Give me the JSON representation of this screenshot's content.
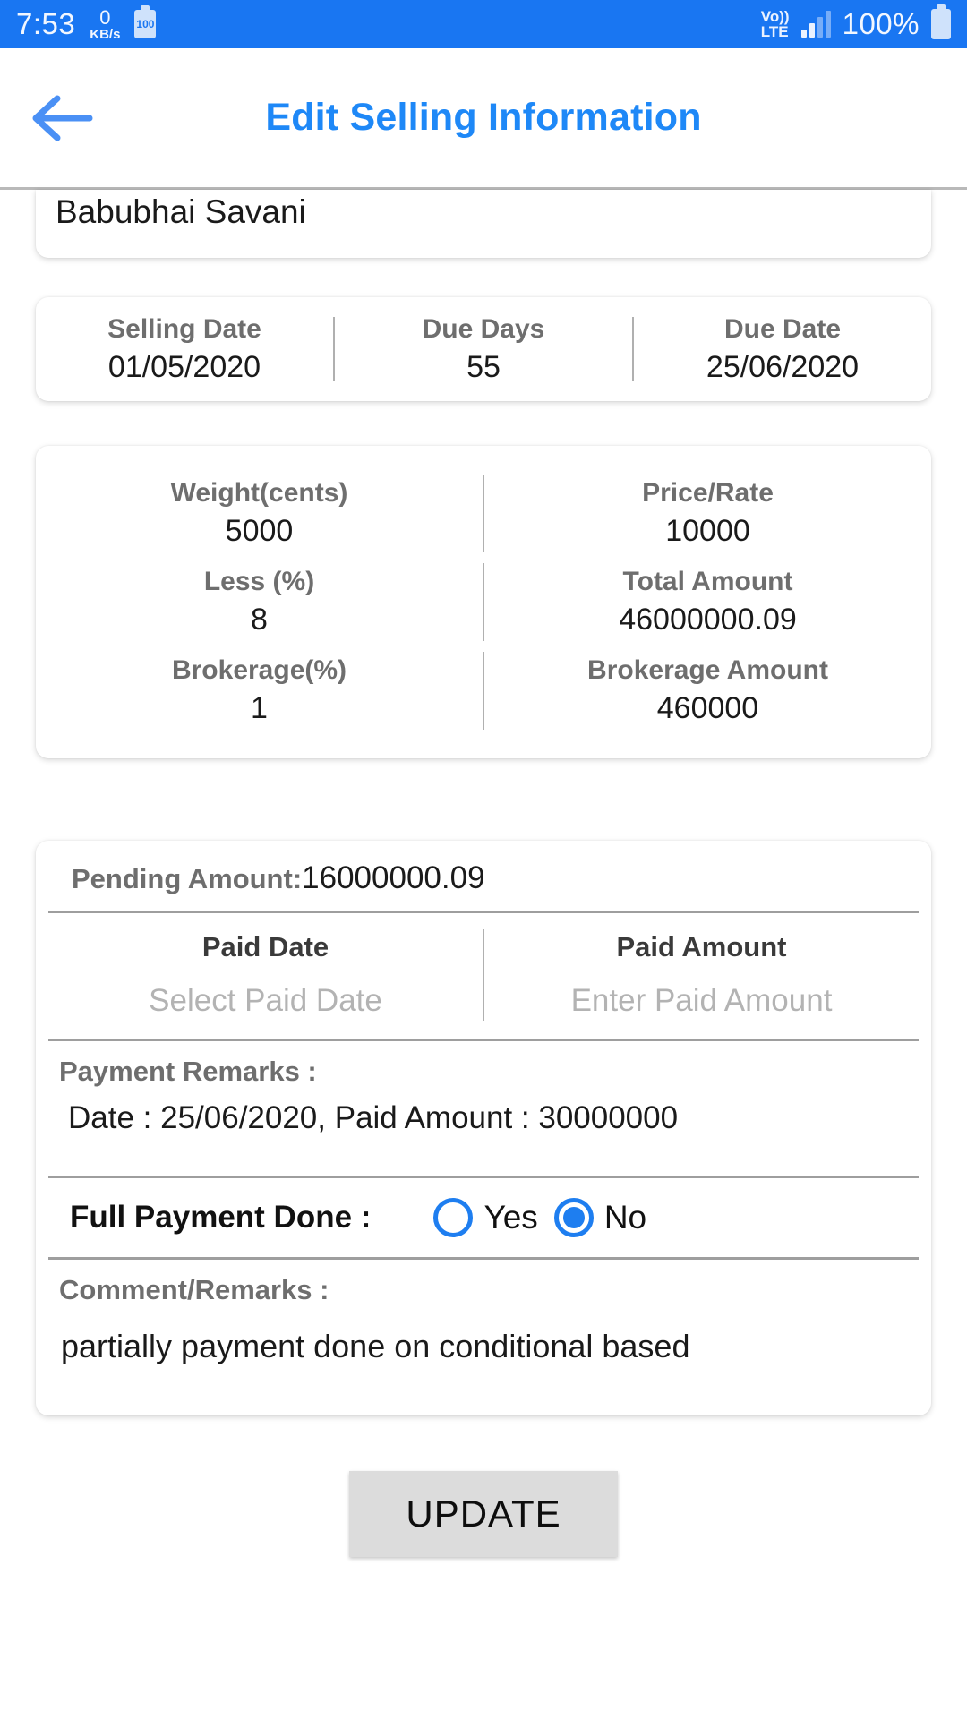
{
  "status_bar": {
    "time": "7:53",
    "net_speed_value": "0",
    "net_speed_unit": "KB/s",
    "battery_badge": "100",
    "volte_top": "Vo))",
    "volte_bottom": "LTE",
    "battery_percent": "100%"
  },
  "appbar": {
    "title": "Edit Selling Information",
    "back_icon": "arrow-left-icon",
    "title_color": "#1e88f7"
  },
  "name_card": {
    "value": "Babubhai Savani"
  },
  "dates_card": {
    "cells": [
      {
        "label": "Selling Date",
        "value": "01/05/2020"
      },
      {
        "label": "Due Days",
        "value": "55"
      },
      {
        "label": "Due Date",
        "value": "25/06/2020"
      }
    ]
  },
  "amounts_card": {
    "rows": [
      {
        "left": {
          "label": "Weight(cents)",
          "value": "5000"
        },
        "right": {
          "label": "Price/Rate",
          "value": "10000"
        }
      },
      {
        "left": {
          "label": "Less (%)",
          "value": "8"
        },
        "right": {
          "label": "Total Amount",
          "value": "46000000.09"
        }
      },
      {
        "left": {
          "label": "Brokerage(%)",
          "value": "1"
        },
        "right": {
          "label": "Brokerage Amount",
          "value": "460000"
        }
      }
    ]
  },
  "payment_card": {
    "pending_label": "Pending Amount:",
    "pending_value": "16000000.09",
    "paid_date": {
      "label": "Paid Date",
      "value": "",
      "placeholder": "Select Paid Date"
    },
    "paid_amount": {
      "label": "Paid Amount",
      "value": "",
      "placeholder": "Enter Paid Amount"
    },
    "payment_remarks_label": "Payment Remarks :",
    "payment_remarks_value": "Date : 25/06/2020, Paid Amount : 30000000",
    "full_payment_label": "Full Payment Done :",
    "radio_yes_label": "Yes",
    "radio_no_label": "No",
    "radio_selected": "No",
    "comment_label": "Comment/Remarks :",
    "comment_value": "partially payment done on conditional based"
  },
  "footer": {
    "update_label": "UPDATE"
  },
  "colors": {
    "accent_blue": "#1976f2",
    "title_blue": "#1e88f7",
    "radio_blue": "#1e7ef0",
    "button_grey": "#dcdcdc",
    "label_grey": "#6e6e6e",
    "divider_grey": "#b0b0b0"
  }
}
